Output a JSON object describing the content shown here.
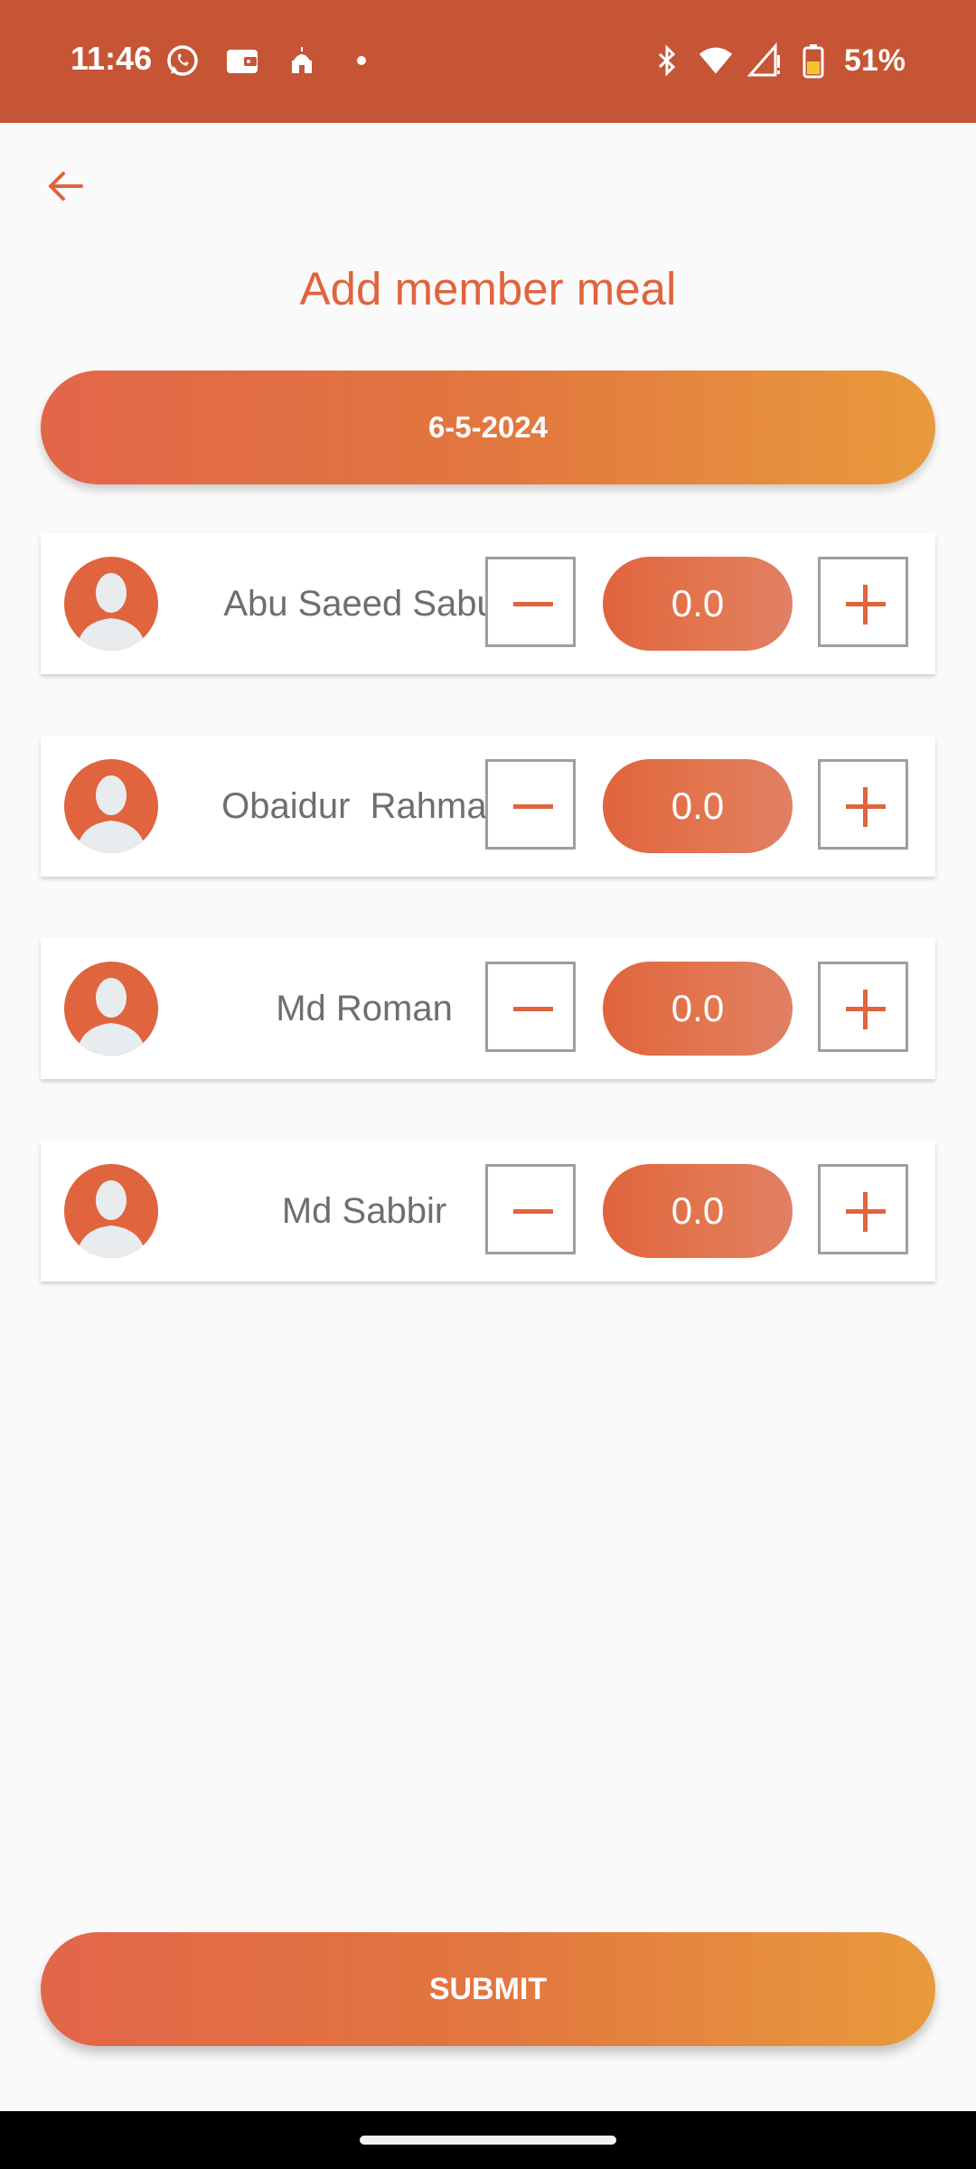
{
  "status_bar": {
    "time": "11:46",
    "battery": "51%",
    "left_icons": [
      "whatsapp-icon",
      "wallet-icon",
      "mosque-icon",
      "notification-dot-icon"
    ],
    "right_icons": [
      "bluetooth-icon",
      "wifi-icon",
      "signal-icon",
      "battery-icon"
    ]
  },
  "header": {
    "back_icon": "arrow-left-icon",
    "title": "Add member meal"
  },
  "date_button": {
    "label": "6-5-2024"
  },
  "members": [
    {
      "name": "Abu Saeed Sabuj",
      "meal": "0.0"
    },
    {
      "name": "Obaidur  Rahman",
      "meal": "0.0"
    },
    {
      "name": "Md Roman",
      "meal": "0.0"
    },
    {
      "name": "Md Sabbir",
      "meal": "0.0"
    }
  ],
  "submit_button": {
    "label": "SUBMIT"
  },
  "colors": {
    "status_bar": "#c55534",
    "accent": "#e0643e",
    "gradient_end": "#e99a3c",
    "background": "#fafafa"
  }
}
